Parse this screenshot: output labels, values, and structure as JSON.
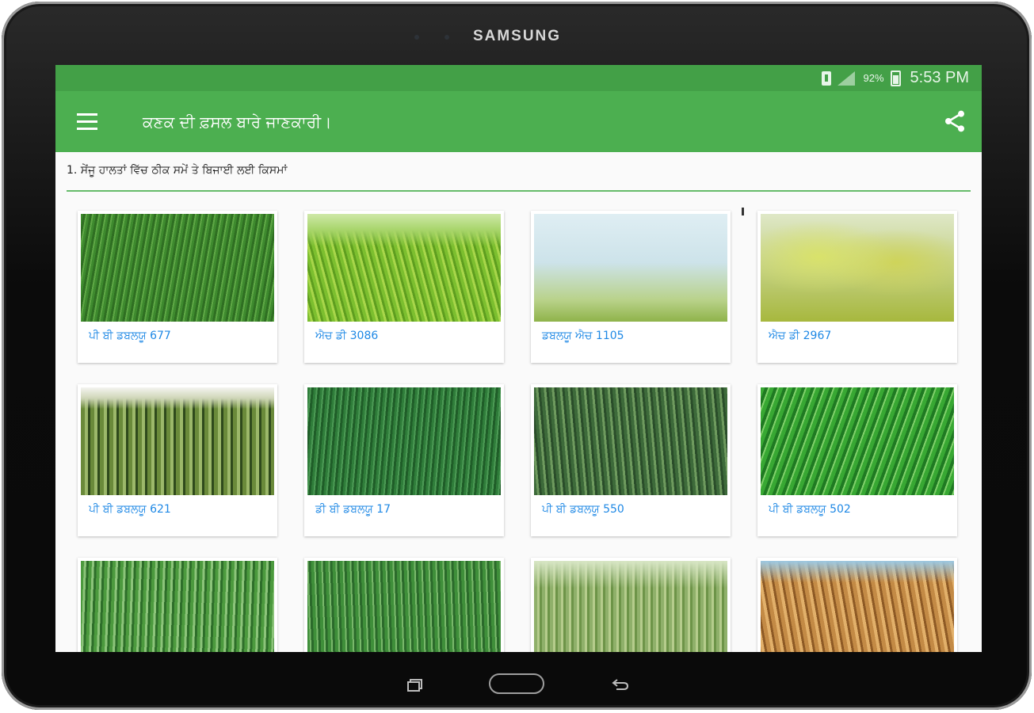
{
  "device": {
    "brand": "SAMSUNG"
  },
  "status_bar": {
    "battery_percent": "92%",
    "time": "5:53 PM"
  },
  "toolbar": {
    "title": "ਕਣਕ ਦੀ ਫ਼ਸਲ ਬਾਰੇ ਜਾਣਕਾਰੀ।"
  },
  "section": {
    "title": "1. ਸੇਂਜੂ ਹਾਲਤਾਂ ਵਿੱਚ ਠੀਕ ਸਮੇਂ ਤੇ ਬਿਜਾਈ ਲਈ ਕਿਸਮਾਂ"
  },
  "varieties": [
    {
      "label": "ਪੀ ਬੀ ਡਬਲਯੂ 677"
    },
    {
      "label": "ਐਚ ਡੀ 3086"
    },
    {
      "label": "ਡਬਲਯੂ ਐਚ 1105"
    },
    {
      "label": "ਐਚ ਡੀ 2967"
    },
    {
      "label": "ਪੀ ਬੀ ਡਬਲਯੂ 621"
    },
    {
      "label": "ਡੀ ਬੀ ਡਬਲਯੂ 17"
    },
    {
      "label": "ਪੀ ਬੀ ਡਬਲਯੂ 550"
    },
    {
      "label": "ਪੀ ਬੀ ਡਬਲਯੂ 502"
    },
    {
      "label": ""
    },
    {
      "label": ""
    },
    {
      "label": ""
    },
    {
      "label": ""
    }
  ],
  "colors": {
    "primary": "#4caf50",
    "primary_dark": "#43a047",
    "link": "#1e88e5",
    "divider": "#66bb6a"
  },
  "icons": {
    "menu": "hamburger-icon",
    "share": "share-icon"
  }
}
